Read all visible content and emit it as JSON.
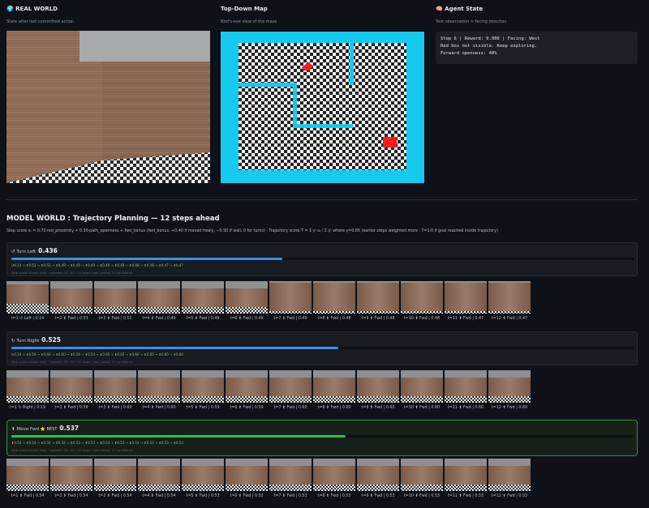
{
  "real_world": {
    "title": "🌍 REAL WORLD",
    "subtitle": "State after last committed action"
  },
  "map": {
    "title": "Top-Down Map",
    "subtitle": "Bird's-eye view of the maze"
  },
  "agent_state": {
    "title": "🧠 Agent State",
    "subtitle": "Text observation + facing direction",
    "line1": "Step 6 | Reward: 0.000 | Facing: West",
    "line2": "Red box not visible. Keep exploring.",
    "line3": "Forward openness: 48%"
  },
  "model_world": {
    "title": "MODEL WORLD : Trajectory Planning — 12 steps ahead",
    "subtitle": "Step score sₜ = 0.70·red_proximity + 0.30·path_openness + fwd_bonus (fwd_bonus: +0.40 if moved freely, −0.50 if wall, 0 for turns) · Trajectory score T = Σ γᵗ·sₜ / Σ γᵗ where γ=0.85 (earlier steps weighted more · T=1.0 if goal reached inside trajectory)"
  },
  "colors": {
    "accent_blue": "#3b8fe6",
    "accent_green": "#2fbf57",
    "map_cyan": "#16c9ee",
    "goal_red": "#ff1a1a"
  },
  "plans": [
    {
      "label": "↺ Turn Left",
      "score": "0.436",
      "progress": 0.436,
      "best": "",
      "chain": "↺0.14 → ⬆0.53 → ⬆0.51 → ⬆0.49 → ⬆0.49 → ⬆0.49 → ⬆0.49 → ⬆0.48 → ⬆0.48 → ⬆0.48 → ⬆0.47 → ⬆0.47",
      "note": "Step scores at each step • segment: 30 / 43 • 12 steps • wall_bumps: 0 • confidence",
      "captions": [
        "t=1 ↺ Left | 0.14",
        "t=2 ⬆ Fwd | 0.53",
        "t=3 ⬆ Fwd | 0.51",
        "t=4 ⬆ Fwd | 0.49",
        "t=5 ⬆ Fwd | 0.49",
        "t=6 ⬆ Fwd | 0.49",
        "t=7 ⬆ Fwd | 0.49",
        "t=8 ⬆ Fwd | 0.48",
        "t=9 ⬆ Fwd | 0.48",
        "t=10 ⬆ Fwd | 0.48",
        "t=11 ⬆ Fwd | 0.47",
        "t=12 ⬆ Fwd | 0.47"
      ]
    },
    {
      "label": "↻ Turn Right",
      "score": "0.525",
      "progress": 0.525,
      "best": "",
      "chain": "↻0.19 → ⬆0.59 → ⬆0.60 → ⬆0.60 → ⬆0.59 → ⬆0.59 → ⬆0.60 → ⬆0.60 → ⬆0.60 → ⬆0.60 → ⬆0.60 → ⬆0.60",
      "note": "Step scores at each step • segment: 30 / 43 • 12 steps • wall_bumps: 0 • confidence",
      "captions": [
        "t=1 ↻ Right | 0.19",
        "t=2 ⬆ Fwd | 0.59",
        "t=3 ⬆ Fwd | 0.60",
        "t=4 ⬆ Fwd | 0.60",
        "t=5 ⬆ Fwd | 0.59",
        "t=6 ⬆ Fwd | 0.59",
        "t=7 ⬆ Fwd | 0.60",
        "t=8 ⬆ Fwd | 0.60",
        "t=9 ⬆ Fwd | 0.60",
        "t=10 ⬆ Fwd | 0.60",
        "t=11 ⬆ Fwd | 0.60",
        "t=12 ⬆ Fwd | 0.60"
      ]
    },
    {
      "label": "⬆ Move Fwd",
      "score": "0.537",
      "progress": 0.537,
      "best": "⭐ BEST",
      "chain": "⬆0.54 → ⬆0.54 → ⬆0.54 → ⬆0.54 → ⬆0.53 → ⬆0.53 → ⬆0.53 → ⬆0.53 → ⬆0.53 → ⬆0.53 → ⬆0.53 → ⬆0.53",
      "note": "Step scores at each step • segment: 30 / 43 • 12 steps • wall_bumps: 0 • confidence",
      "captions": [
        "t=1 ⬆ Fwd | 0.54",
        "t=2 ⬆ Fwd | 0.54",
        "t=3 ⬆ Fwd | 0.54",
        "t=4 ⬆ Fwd | 0.54",
        "t=5 ⬆ Fwd | 0.53",
        "t=6 ⬆ Fwd | 0.53",
        "t=7 ⬆ Fwd | 0.53",
        "t=8 ⬆ Fwd | 0.53",
        "t=9 ⬆ Fwd | 0.53",
        "t=10 ⬆ Fwd | 0.53",
        "t=11 ⬆ Fwd | 0.53",
        "t=12 ⬆ Fwd | 0.53"
      ]
    }
  ]
}
